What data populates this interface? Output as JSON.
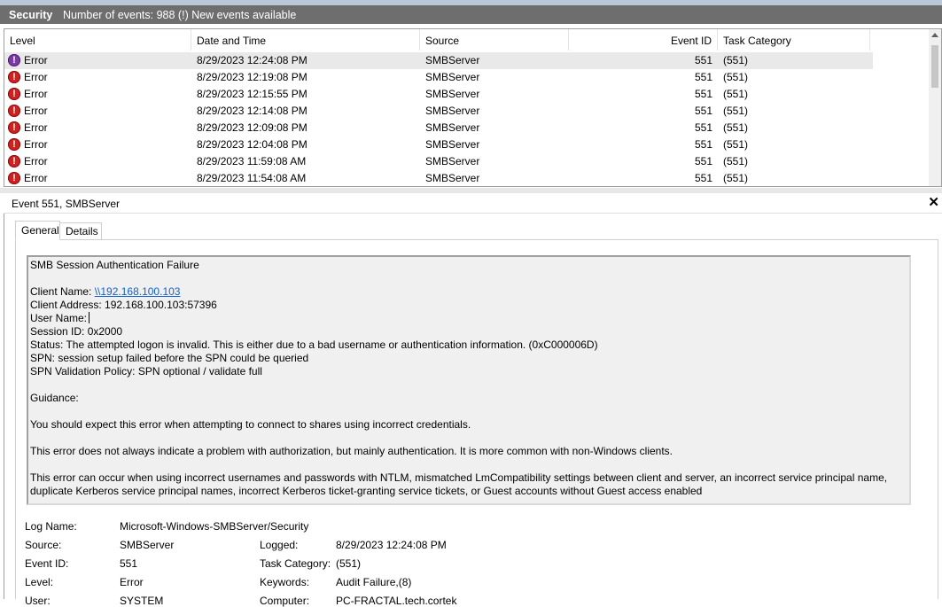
{
  "window": {
    "title": "Security",
    "events_summary": "Number of events: 988 (!) New events available"
  },
  "grid": {
    "columns": [
      "Level",
      "Date and Time",
      "Source",
      "Event ID",
      "Task Category"
    ],
    "rows": [
      {
        "level": "Error",
        "datetime": "8/29/2023 12:24:08 PM",
        "source": "SMBServer",
        "event_id": "551",
        "task": "(551)"
      },
      {
        "level": "Error",
        "datetime": "8/29/2023 12:19:08 PM",
        "source": "SMBServer",
        "event_id": "551",
        "task": "(551)"
      },
      {
        "level": "Error",
        "datetime": "8/29/2023 12:15:55 PM",
        "source": "SMBServer",
        "event_id": "551",
        "task": "(551)"
      },
      {
        "level": "Error",
        "datetime": "8/29/2023 12:14:08 PM",
        "source": "SMBServer",
        "event_id": "551",
        "task": "(551)"
      },
      {
        "level": "Error",
        "datetime": "8/29/2023 12:09:08 PM",
        "source": "SMBServer",
        "event_id": "551",
        "task": "(551)"
      },
      {
        "level": "Error",
        "datetime": "8/29/2023 12:04:08 PM",
        "source": "SMBServer",
        "event_id": "551",
        "task": "(551)"
      },
      {
        "level": "Error",
        "datetime": "8/29/2023 11:59:08 AM",
        "source": "SMBServer",
        "event_id": "551",
        "task": "(551)"
      },
      {
        "level": "Error",
        "datetime": "8/29/2023 11:54:08 AM",
        "source": "SMBServer",
        "event_id": "551",
        "task": "(551)"
      }
    ],
    "error_glyph": "!"
  },
  "detail": {
    "title": "Event 551, SMBServer",
    "close_glyph": "✕",
    "tabs": [
      "General",
      "Details"
    ],
    "message": {
      "heading": "SMB Session Authentication Failure",
      "client_name_label": "Client Name: ",
      "client_name_value": "\\\\192.168.100.103",
      "client_address": "Client Address: 192.168.100.103:57396",
      "user_name": "User Name:",
      "session_id": "Session ID: 0x2000",
      "status": "Status: The attempted logon is invalid. This is either due to a bad username or authentication information. (0xC000006D)",
      "spn": "SPN: session setup failed before the SPN could be queried",
      "spn_policy": "SPN Validation Policy: SPN optional / validate full",
      "guidance": "Guidance:",
      "p1": "You should expect this error when attempting to connect to shares using incorrect credentials.",
      "p2": "This error does not always indicate a problem with authorization, but mainly authentication. It is more common with non-Windows clients.",
      "p3a": "This error can occur when using incorrect usernames and passwords with NTLM, mismatched LmCompatibility settings between client and server, an incorrect service principal name,",
      "p3b": "duplicate Kerberos service principal names, incorrect Kerberos ticket-granting service tickets, or Guest accounts without Guest access enabled"
    },
    "props": {
      "log_name_label": "Log Name:",
      "log_name": "Microsoft-Windows-SMBServer/Security",
      "source_label": "Source:",
      "source": "SMBServer",
      "logged_label": "Logged:",
      "logged": "8/29/2023 12:24:08 PM",
      "event_id_label": "Event ID:",
      "event_id": "551",
      "task_label": "Task Category:",
      "task": "(551)",
      "level_label": "Level:",
      "level": "Error",
      "keywords_label": "Keywords:",
      "keywords": "Audit Failure,(8)",
      "user_label": "User:",
      "user": "SYSTEM",
      "computer_label": "Computer:",
      "computer": "PC-FRACTAL.tech.cortek"
    }
  },
  "colors": {
    "titlebar": "#6e6e6e",
    "link": "#1560c7",
    "error_icon": "#d02020",
    "selected_row": "#e9e9e9"
  }
}
